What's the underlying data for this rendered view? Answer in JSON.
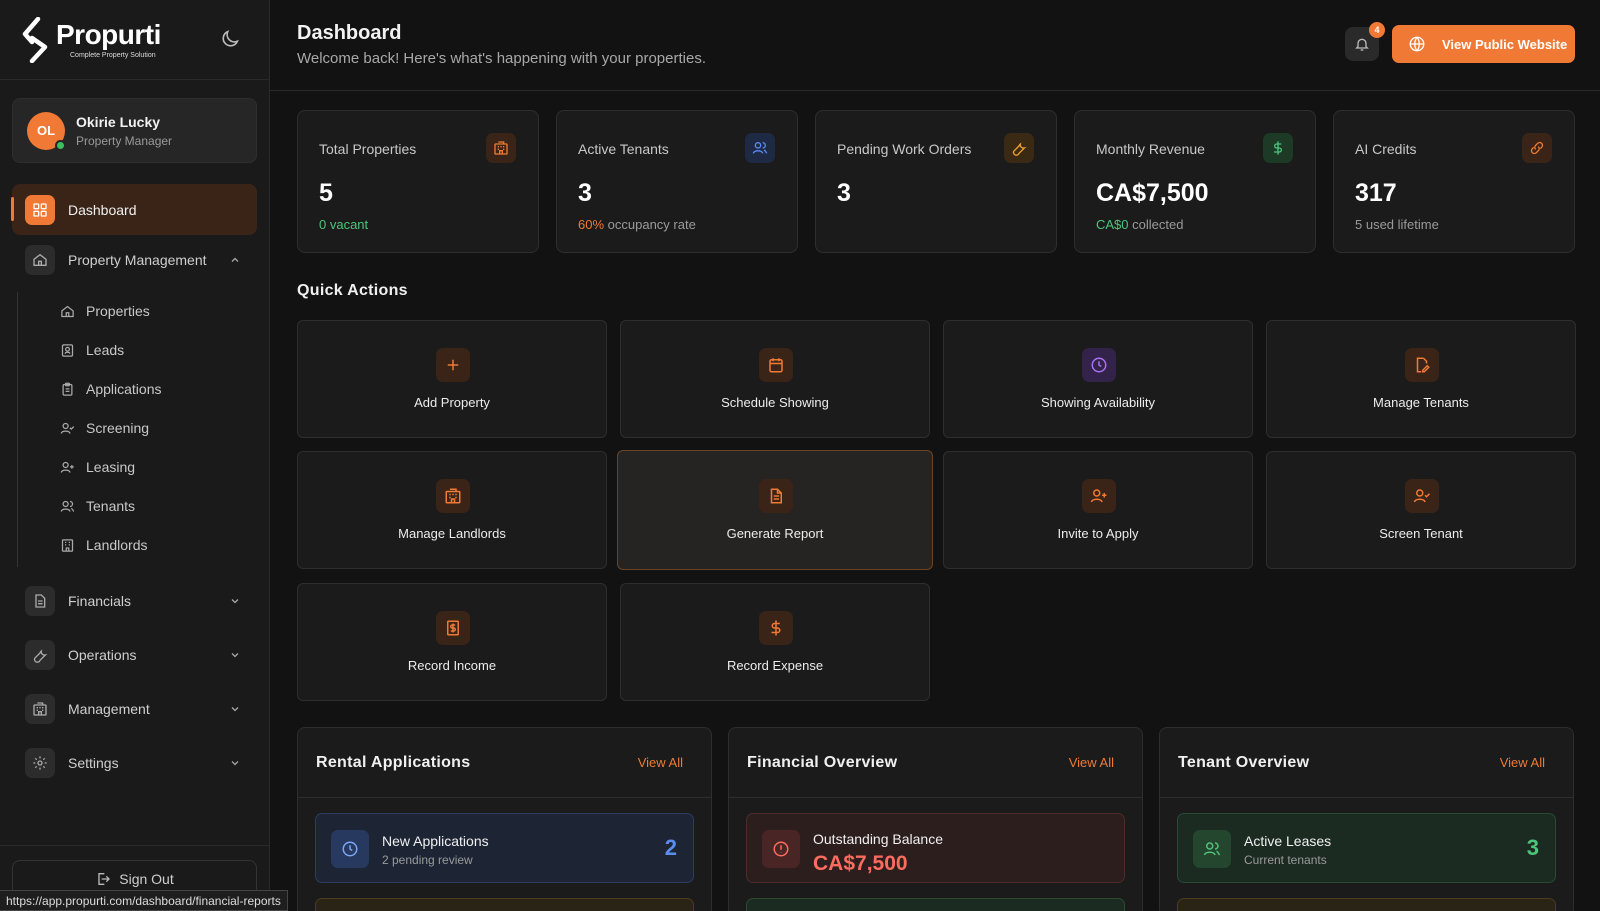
{
  "brand": {
    "name": "Propurti",
    "tagline": "Complete Property Solution"
  },
  "user": {
    "initials": "OL",
    "name": "Okirie Lucky",
    "role": "Property Manager"
  },
  "nav": {
    "active": "Dashboard",
    "property_management": "Property Management",
    "sub_items": [
      "Properties",
      "Leads",
      "Applications",
      "Screening",
      "Leasing",
      "Tenants",
      "Landlords"
    ],
    "financials": "Financials",
    "operations": "Operations",
    "management": "Management",
    "settings": "Settings"
  },
  "sign_out": "Sign Out",
  "status_url": "https://app.propurti.com/dashboard/financial-reports",
  "header": {
    "title": "Dashboard",
    "subtitle": "Welcome back! Here's what's happening with your properties.",
    "notification_count": "4",
    "public_button": "View Public Website"
  },
  "stats": [
    {
      "label": "Total Properties",
      "value": "5",
      "note_highlight": "0 vacant",
      "note_rest": ""
    },
    {
      "label": "Active Tenants",
      "value": "3",
      "note_highlight": "60%",
      "note_rest": " occupancy rate"
    },
    {
      "label": "Pending Work Orders",
      "value": "3",
      "note_highlight": "",
      "note_rest": ""
    },
    {
      "label": "Monthly Revenue",
      "value": "CA$7,500",
      "note_highlight": "CA$0",
      "note_rest": " collected"
    },
    {
      "label": "AI Credits",
      "value": "317",
      "note_highlight": "",
      "note_rest": "5 used lifetime"
    }
  ],
  "quick_actions": {
    "title": "Quick Actions",
    "items": [
      "Add Property",
      "Schedule Showing",
      "Showing Availability",
      "Manage Tenants",
      "Manage Landlords",
      "Generate Report",
      "Invite to Apply",
      "Screen Tenant",
      "Record Income",
      "Record Expense"
    ]
  },
  "panels": {
    "rental": {
      "title": "Rental Applications",
      "link": "View All",
      "row_title": "New Applications",
      "row_sub": "2 pending review",
      "row_count": "2"
    },
    "financial": {
      "title": "Financial Overview",
      "link": "View All",
      "row_title": "Outstanding Balance",
      "row_value": "CA$7,500"
    },
    "tenant": {
      "title": "Tenant Overview",
      "link": "View All",
      "row_title": "Active Leases",
      "row_sub": "Current tenants",
      "row_count": "3"
    }
  },
  "colors": {
    "accent": "#f07a35",
    "background": "#121212",
    "panel": "#1b1b1b",
    "success": "#4ec47b",
    "info": "#5b8def",
    "danger": "#ff6b5e"
  }
}
